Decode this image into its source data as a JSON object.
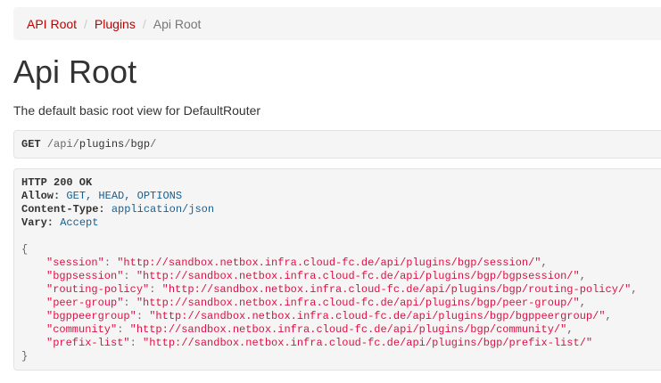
{
  "breadcrumb": {
    "items": [
      {
        "label": "API Root"
      },
      {
        "label": "Plugins"
      },
      {
        "label": "Api Root"
      }
    ],
    "separator": "/"
  },
  "page": {
    "title": "Api Root",
    "description": "The default basic root view for DefaultRouter"
  },
  "request": {
    "method": "GET",
    "path_parts": [
      "api",
      "plugins",
      "bgp"
    ],
    "slash": "/"
  },
  "response": {
    "status": "HTTP 200 OK",
    "headers": [
      {
        "name": "Allow:",
        "value": "GET, HEAD, OPTIONS"
      },
      {
        "name": "Content-Type:",
        "value": "application/json"
      },
      {
        "name": "Vary:",
        "value": "Accept"
      }
    ],
    "open_brace": "{",
    "close_brace": "}",
    "entries": [
      {
        "key": "\"session\"",
        "url": "\"http://sandbox.netbox.infra.cloud-fc.de/api/plugins/bgp/session/\"",
        "comma": ","
      },
      {
        "key": "\"bgpsession\"",
        "url": "\"http://sandbox.netbox.infra.cloud-fc.de/api/plugins/bgp/bgpsession/\"",
        "comma": ","
      },
      {
        "key": "\"routing-policy\"",
        "url": "\"http://sandbox.netbox.infra.cloud-fc.de/api/plugins/bgp/routing-policy/\"",
        "comma": ","
      },
      {
        "key": "\"peer-group\"",
        "url": "\"http://sandbox.netbox.infra.cloud-fc.de/api/plugins/bgp/peer-group/\"",
        "comma": ","
      },
      {
        "key": "\"bgppeergroup\"",
        "url": "\"http://sandbox.netbox.infra.cloud-fc.de/api/plugins/bgp/bgppeergroup/\"",
        "comma": ","
      },
      {
        "key": "\"community\"",
        "url": "\"http://sandbox.netbox.infra.cloud-fc.de/api/plugins/bgp/community/\"",
        "comma": ","
      },
      {
        "key": "\"prefix-list\"",
        "url": "\"http://sandbox.netbox.infra.cloud-fc.de/api/plugins/bgp/prefix-list/\"",
        "comma": ""
      }
    ],
    "colon": ":"
  }
}
